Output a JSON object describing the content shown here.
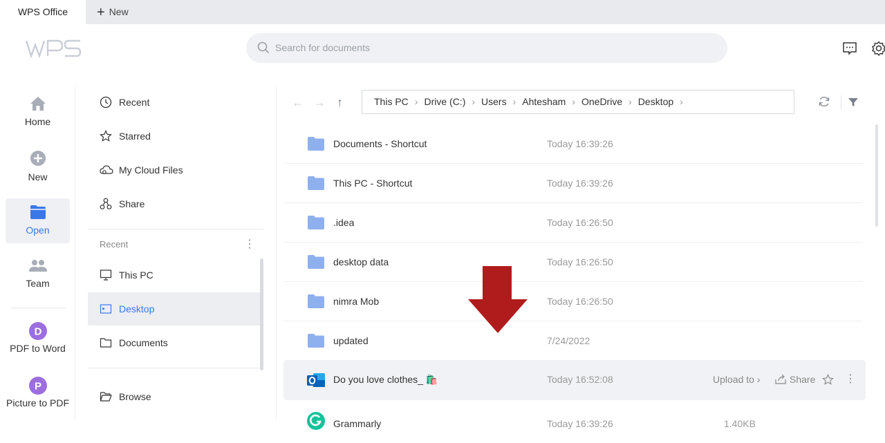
{
  "tabs": {
    "active": "WPS Office",
    "new_label": "New"
  },
  "search": {
    "placeholder": "Search for documents"
  },
  "rail": [
    {
      "label": "Home",
      "icon": "home-icon"
    },
    {
      "label": "New",
      "icon": "plus-circle-icon"
    },
    {
      "label": "Open",
      "icon": "folder-icon",
      "active": true
    },
    {
      "label": "Team",
      "icon": "team-icon"
    },
    {
      "label": "PDF to Word",
      "icon": "pdf-to-word-icon"
    },
    {
      "label": "Picture to PDF",
      "icon": "picture-to-pdf-icon"
    }
  ],
  "sidebar": {
    "top_items": [
      "Recent",
      "Starred",
      "My Cloud Files",
      "Share"
    ],
    "recent_heading": "Recent",
    "locations": [
      "This PC",
      "Desktop",
      "Documents"
    ],
    "active_location": "Desktop",
    "browse": "Browse"
  },
  "breadcrumb": [
    "This PC",
    "Drive (C:)",
    "Users",
    "Ahtesham",
    "OneDrive",
    "Desktop"
  ],
  "files": [
    {
      "name": "Documents - Shortcut",
      "date": "Today 16:39:26",
      "type": "folder"
    },
    {
      "name": "This PC - Shortcut",
      "date": "Today 16:39:26",
      "type": "folder"
    },
    {
      "name": ".idea",
      "date": "Today 16:26:50",
      "type": "folder"
    },
    {
      "name": "desktop data",
      "date": "Today 16:26:50",
      "type": "folder"
    },
    {
      "name": "nimra Mob",
      "date": "Today 16:26:50",
      "type": "folder"
    },
    {
      "name": "updated",
      "date": "7/24/2022",
      "type": "folder"
    },
    {
      "name": "Do you love clothes_ 🛍️",
      "date": "Today 16:52:08",
      "type": "outlook",
      "upload_label": "Upload to",
      "share_label": "Share"
    },
    {
      "name": "Grammarly",
      "date": "Today 16:39:26",
      "type": "grammarly",
      "size": "1.40KB"
    }
  ],
  "colors": {
    "accent": "#3a78e8",
    "folder": "#8fb0ee",
    "red_arrow": "#b01c1c"
  }
}
